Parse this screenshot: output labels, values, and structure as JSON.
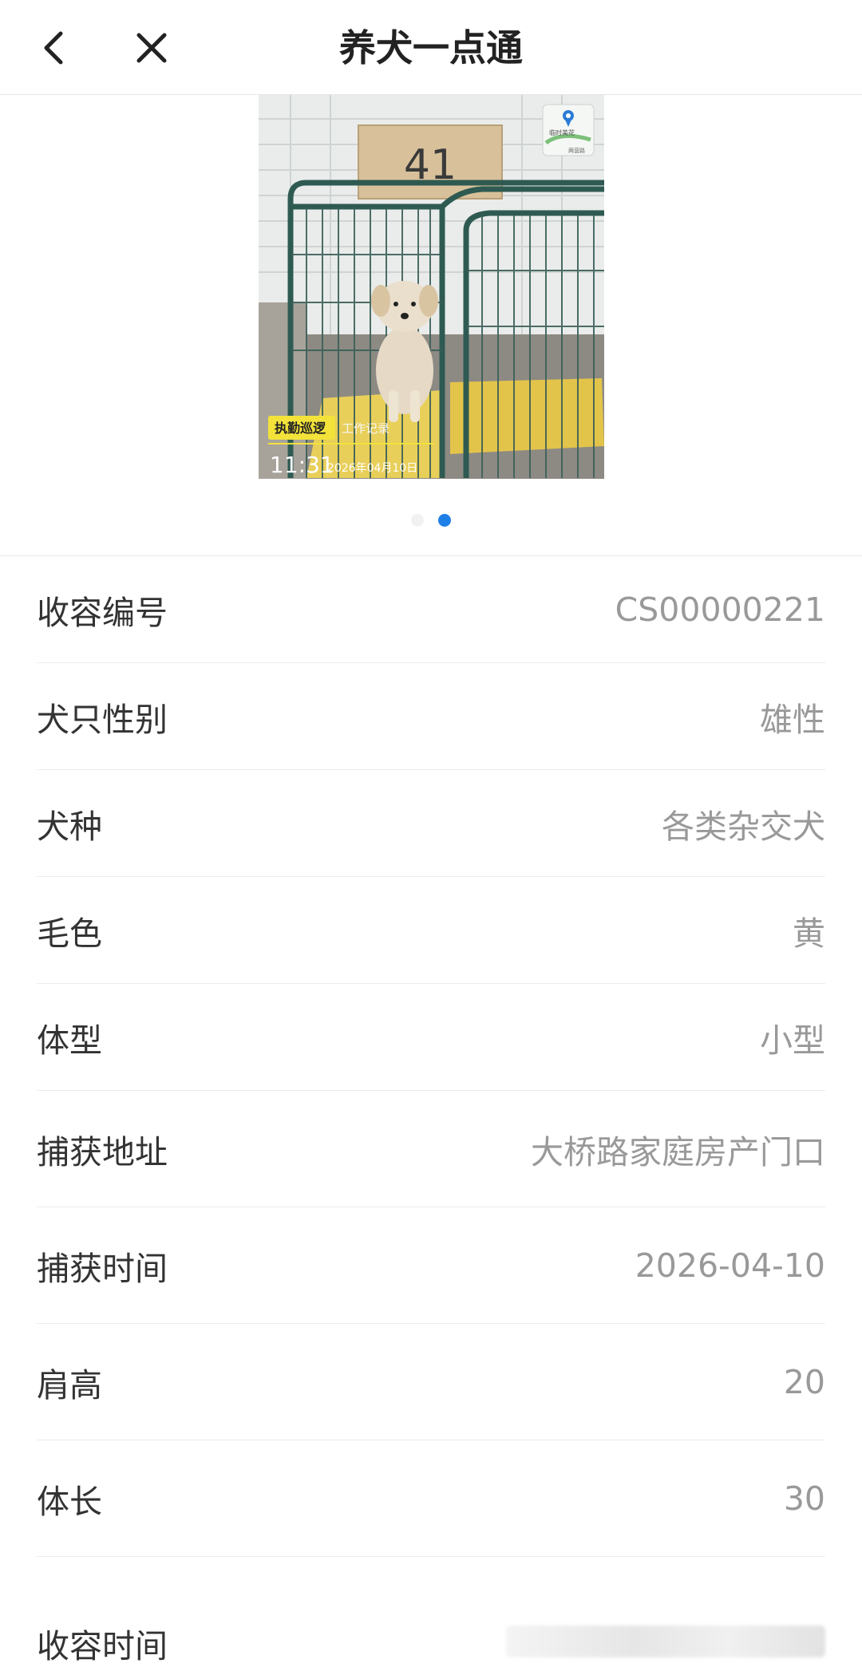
{
  "header": {
    "title": "养犬一点通",
    "back_icon": "chevron-left-icon",
    "close_icon": "close-icon"
  },
  "photo": {
    "cage_number": "41",
    "badge_left": "执勤巡逻",
    "badge_right": "工作记录",
    "time": "11:31",
    "date": "2026年04月10日",
    "map_label": "临时美花",
    "map_sub": "两营路"
  },
  "carousel": {
    "total": 2,
    "active_index": 1
  },
  "info": {
    "rows": [
      {
        "label": "收容编号",
        "value": "CS00000221"
      },
      {
        "label": "犬只性别",
        "value": "雄性"
      },
      {
        "label": "犬种",
        "value": "各类杂交犬"
      },
      {
        "label": "毛色",
        "value": "黄"
      },
      {
        "label": "体型",
        "value": "小型"
      },
      {
        "label": "捕获地址",
        "value": "大桥路家庭房产门口"
      },
      {
        "label": "捕获时间",
        "value": "2026-04-10"
      },
      {
        "label": "肩高",
        "value": "20"
      },
      {
        "label": "体长",
        "value": "30"
      },
      {
        "label": "收容时间",
        "value": ""
      }
    ]
  },
  "colors": {
    "accent": "#1e80e6",
    "label": "#333333",
    "value": "#999999",
    "divider": "#ececec"
  }
}
